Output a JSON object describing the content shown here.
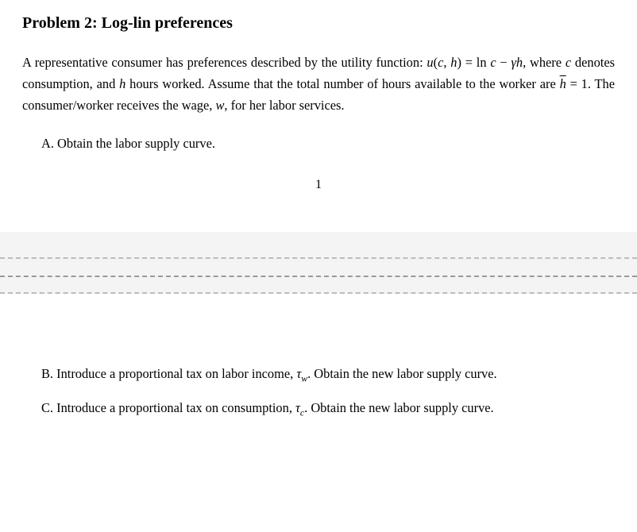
{
  "title": "Problem 2: Log-lin preferences",
  "intro": {
    "seg1": "A representative consumer has preferences described by the utility function: ",
    "u_expr_lhs": "u",
    "u_expr_args_open": "(",
    "u_c": "c",
    "u_comma": ", ",
    "u_h": "h",
    "u_expr_args_close": ")",
    "eq": " = ln ",
    "c2": "c",
    "minus": " − ",
    "gamma": "γ",
    "h2": "h",
    "seg2": ", where ",
    "c3": "c",
    "seg3": " denotes consumption, and ",
    "h3": "h",
    "seg4": " hours worked. Assume that the total number of hours available to the worker are ",
    "hbar": "h",
    "eq1": " = 1. The consumer/worker receives the wage, ",
    "w": "w",
    "seg5": ", for her labor services."
  },
  "items": {
    "a": "A. Obtain the labor supply curve.",
    "b_pre": "B. Introduce a proportional tax on labor income, ",
    "b_tau": "τ",
    "b_sub": "w",
    "b_post": ". Obtain the new labor supply curve.",
    "c_pre": "C. Introduce a proportional tax on consumption, ",
    "c_tau": "τ",
    "c_sub": "c",
    "c_post": ". Obtain the new labor supply curve."
  },
  "page_number": "1"
}
